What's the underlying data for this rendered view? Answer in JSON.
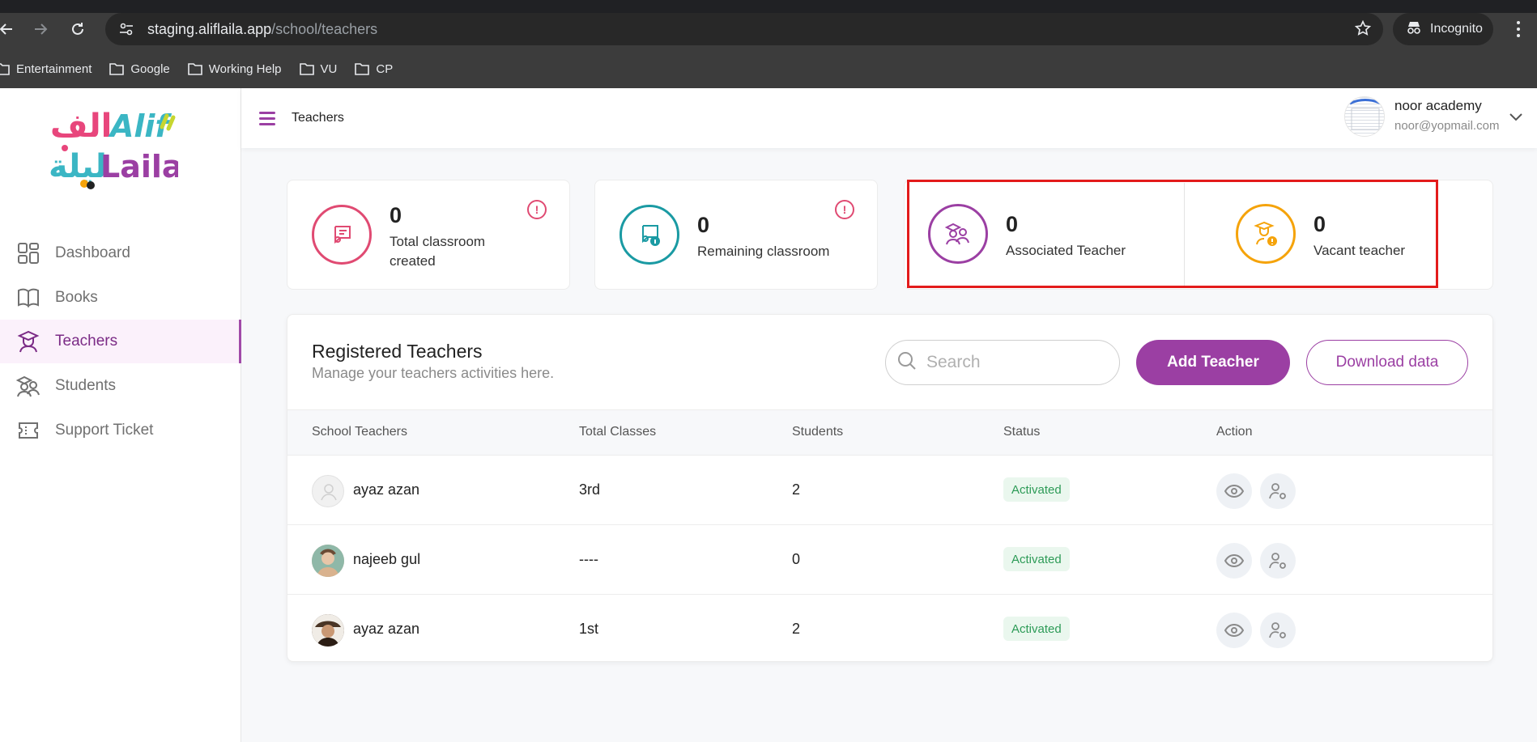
{
  "browser": {
    "url_host": "staging.aliflaila.app",
    "url_path": "/school/teachers",
    "incognito_label": "Incognito",
    "bookmarks": [
      "Entertainment",
      "Google",
      "Working Help",
      "VU",
      "CP"
    ]
  },
  "sidebar": {
    "logo_arabic_top": "الف",
    "logo_latin_top": "Alif",
    "logo_arabic_bottom": "ليلة",
    "logo_latin_bottom": "Laila",
    "items": [
      {
        "label": "Dashboard",
        "icon": "grid-icon"
      },
      {
        "label": "Books",
        "icon": "book-icon"
      },
      {
        "label": "Teachers",
        "icon": "teacher-icon",
        "active": true
      },
      {
        "label": "Students",
        "icon": "students-icon"
      },
      {
        "label": "Support Ticket",
        "icon": "ticket-icon"
      }
    ]
  },
  "header": {
    "title": "Teachers",
    "user_name": "noor academy",
    "user_email": "noor@yopmail.com"
  },
  "stats": [
    {
      "value": "0",
      "label": "Total classroom created",
      "color": "#e04a72"
    },
    {
      "value": "0",
      "label": "Remaining classroom",
      "color": "#1a9aa3"
    },
    {
      "value": "0",
      "label": "Associated Teacher",
      "color": "#9b3fa3"
    },
    {
      "value": "0",
      "label": "Vacant teacher",
      "color": "#f5a30a"
    }
  ],
  "panel": {
    "title": "Registered Teachers",
    "subtitle": "Manage your teachers activities here.",
    "search_placeholder": "Search",
    "add_button": "Add Teacher",
    "download_button": "Download data",
    "columns": [
      "School Teachers",
      "Total Classes",
      "Students",
      "Status",
      "Action"
    ],
    "rows": [
      {
        "name": "ayaz azan",
        "classes": "3rd",
        "students": "2",
        "status": "Activated"
      },
      {
        "name": "najeeb gul",
        "classes": "----",
        "students": "0",
        "status": "Activated"
      },
      {
        "name": "ayaz azan",
        "classes": "1st",
        "students": "2",
        "status": "Activated"
      }
    ]
  },
  "colors": {
    "accent": "#9b3fa3",
    "highlight": "#e31b1b",
    "status_green": "#2d9b57"
  }
}
